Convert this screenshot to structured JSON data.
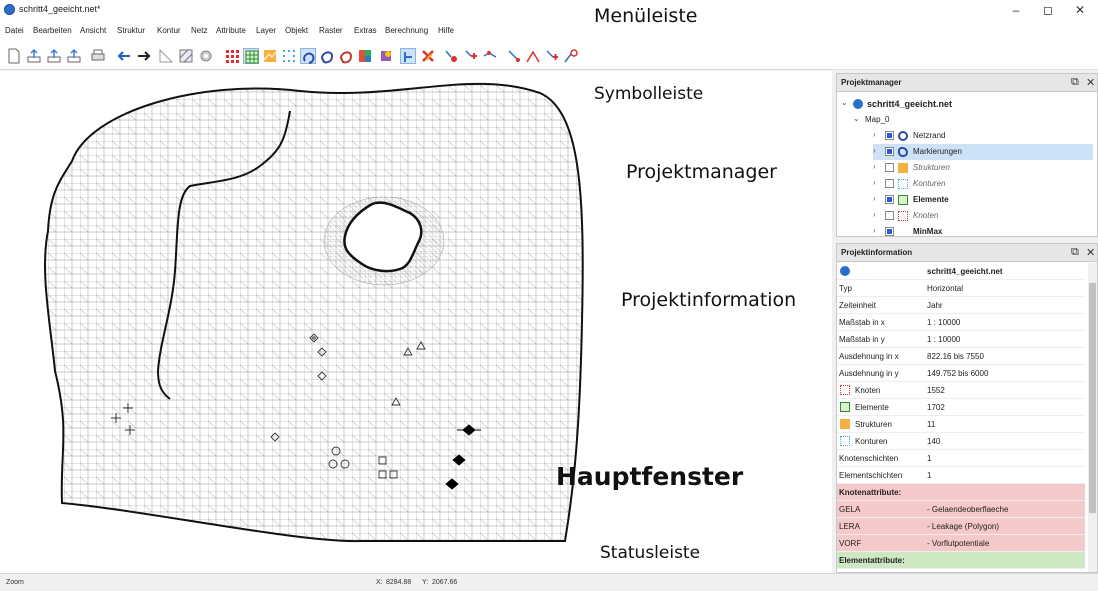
{
  "window": {
    "title": "schritt4_geeicht.net*",
    "controls": [
      "–",
      "◻",
      "✕"
    ]
  },
  "menu": [
    "Datei",
    "Bearbeiten",
    "Ansicht",
    "Struktur",
    "Kontur",
    "Netz",
    "Attribute",
    "Layer",
    "Objekt",
    "Raster",
    "Extras",
    "Berechnung",
    "Hilfe"
  ],
  "toolbar": {
    "icons": [
      "new-file-icon",
      "import-icon",
      "export-icon",
      "export-alt-icon",
      "print-icon",
      "arrow-left-icon",
      "arrow-right-icon",
      "select-triangle-icon",
      "hatch-icon",
      "gear-icon",
      "nodes-grid-icon",
      "elements-grid-icon",
      "structures-icon",
      "contours-icon",
      "markers-icon",
      "boundary-icon",
      "polygon-icon",
      "palette-icon",
      "layers-icon",
      "attribute-icon",
      "delete-icon",
      "point-tool-icon",
      "move-tool-icon",
      "insert-tool-icon",
      "edge-tool-icon",
      "split-tool-icon",
      "join-tool-icon",
      "refine-tool-icon"
    ]
  },
  "annotations": {
    "menu": "Menüleiste",
    "toolbar": "Symbolleiste",
    "project_manager": "Projektmanager",
    "project_info": "Projektinformation",
    "main": "Hauptfenster",
    "status": "Statusleiste"
  },
  "project_manager": {
    "title": "Projektmanager",
    "root": "schritt4_geeicht.net",
    "map": "Map_0",
    "layers": [
      {
        "label": "Netzrand",
        "checked": true,
        "icon": "boundary-icon",
        "style": "normal"
      },
      {
        "label": "Markierungen",
        "checked": true,
        "icon": "markers-icon",
        "style": "selected"
      },
      {
        "label": "Strukturen",
        "checked": false,
        "icon": "structures-icon",
        "style": "italic"
      },
      {
        "label": "Konturen",
        "checked": false,
        "icon": "contours-icon",
        "style": "italic"
      },
      {
        "label": "Elemente",
        "checked": true,
        "icon": "elements-grid-icon",
        "style": "bold"
      },
      {
        "label": "Knoten",
        "checked": false,
        "icon": "nodes-grid-icon",
        "style": "italic"
      },
      {
        "label": "MinMax",
        "checked": true,
        "icon": "",
        "style": "bold"
      }
    ]
  },
  "project_info": {
    "title": "Projektinformation",
    "filename": "schritt4_geeicht.net",
    "rows": [
      {
        "key": "Typ",
        "value": "Horizontal"
      },
      {
        "key": "Zeiteinheit",
        "value": "Jahr"
      },
      {
        "key": "Maßstab in x",
        "value": "1 : 10000"
      },
      {
        "key": "Maßstab in y",
        "value": "1 : 10000"
      },
      {
        "key": "Ausdehnung in x",
        "value": "822.16 bis 7550"
      },
      {
        "key": "Ausdehnung in y",
        "value": "149.752 bis 6000"
      },
      {
        "key": "Knoten",
        "value": "1552",
        "icon": "nodes-grid-icon"
      },
      {
        "key": "Elemente",
        "value": "1702",
        "icon": "elements-grid-icon"
      },
      {
        "key": "Strukturen",
        "value": "11",
        "icon": "structures-icon"
      },
      {
        "key": "Konturen",
        "value": "140",
        "icon": "contours-icon"
      },
      {
        "key": "Knotenschichten",
        "value": "1"
      },
      {
        "key": "Elementschichten",
        "value": "1"
      }
    ],
    "node_attr_title": "Knotenattribute:",
    "node_attrs": [
      {
        "key": "GELA",
        "value": "- Gelaendeoberflaeche"
      },
      {
        "key": "LERA",
        "value": "- Leakage (Polygon)"
      },
      {
        "key": "VORF",
        "value": "- Vorflutpotentiale"
      }
    ],
    "element_attr_title": "Elementattribute:",
    "colors": {
      "node_attr_bg": "#f5c9c9",
      "element_attr_bg": "#cfe8c4"
    }
  },
  "status": {
    "mode": "Zoom",
    "x_label": "X:",
    "x_value": "8284.88",
    "y_label": "Y:",
    "y_value": "2067.66"
  },
  "colors": {
    "accent": "#2a6fc9",
    "selection": "#cde2f7"
  }
}
